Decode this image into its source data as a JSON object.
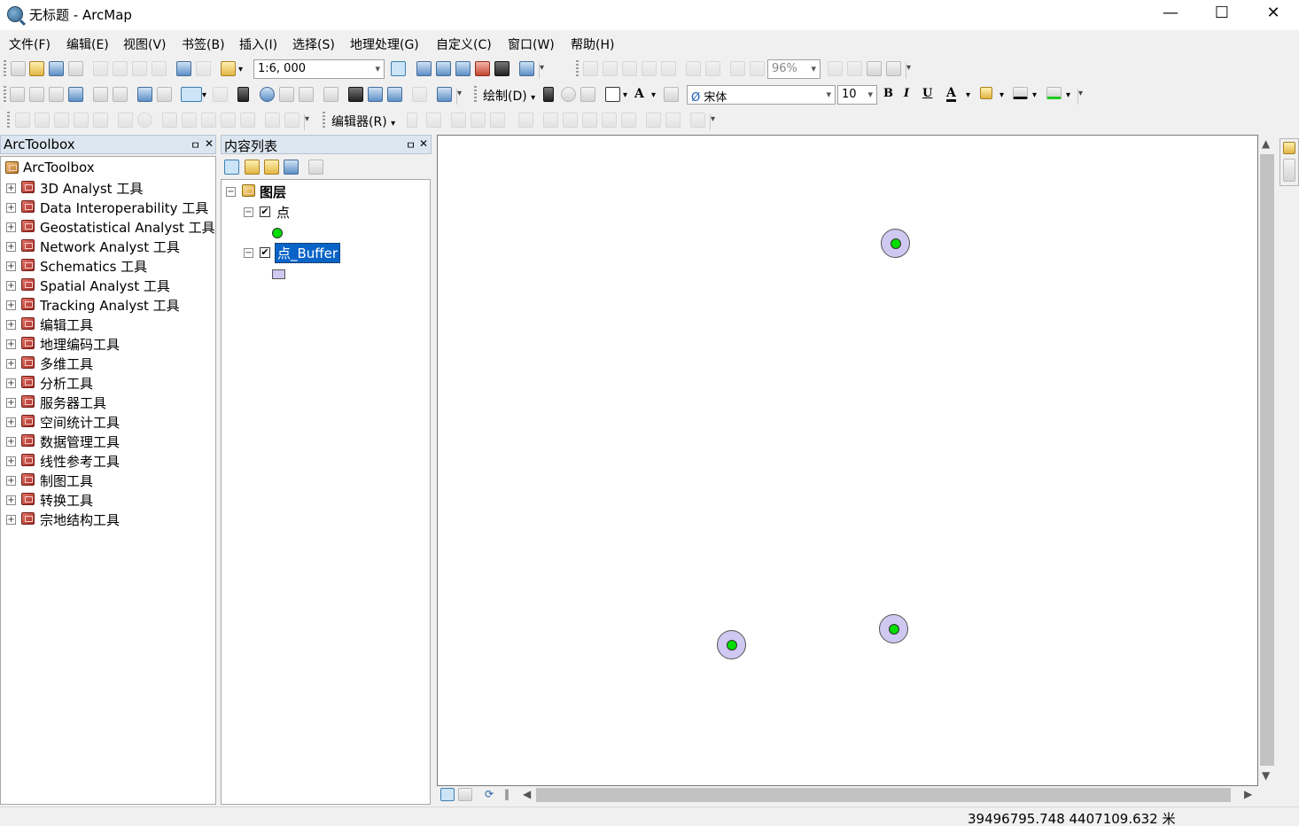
{
  "window": {
    "title": "无标题 - ArcMap",
    "controls": {
      "minimize": "—",
      "maximize": "☐",
      "close": "✕"
    }
  },
  "menubar": [
    "文件(F)",
    "编辑(E)",
    "视图(V)",
    "书签(B)",
    "插入(I)",
    "选择(S)",
    "地理处理(G)",
    "自定义(C)",
    "窗口(W)",
    "帮助(H)"
  ],
  "toolbar": {
    "scale": "1:6, 000",
    "zoom_percent": "96%",
    "draw_label": "绘制(D)",
    "font_name": "宋体",
    "font_size": "10",
    "bold": "B",
    "italic": "I",
    "underline": "U",
    "font_color_glyph": "A",
    "text_tool_glyph": "A",
    "editor_label": "编辑器(R)"
  },
  "arctoolbox": {
    "title": "ArcToolbox",
    "root": "ArcToolbox",
    "pin": "ㅁ",
    "close": "✕",
    "items": [
      "3D Analyst 工具",
      "Data Interoperability 工具",
      "Geostatistical Analyst 工具",
      "Network Analyst 工具",
      "Schematics 工具",
      "Spatial Analyst 工具",
      "Tracking Analyst 工具",
      "编辑工具",
      "地理编码工具",
      "多维工具",
      "分析工具",
      "服务器工具",
      "空间统计工具",
      "数据管理工具",
      "线性参考工具",
      "制图工具",
      "转换工具",
      "宗地结构工具"
    ]
  },
  "toc": {
    "title": "内容列表",
    "group": "图层",
    "layers": [
      {
        "name": "点",
        "checked": true,
        "symbol": "green-point"
      },
      {
        "name": "点_Buffer",
        "checked": true,
        "symbol": "lavender-polygon",
        "selected": true
      }
    ]
  },
  "map": {
    "point_color": "#00dd00",
    "buffer_color": "#cfc8f0",
    "features": [
      {
        "name": "point-north"
      },
      {
        "name": "point-southwest"
      },
      {
        "name": "point-southeast"
      }
    ]
  },
  "statusbar": {
    "coordinates": "39496795.748  4407109.632 米"
  },
  "colors": {
    "accent": "#0078d7",
    "panel_header": "#dce6f0"
  }
}
